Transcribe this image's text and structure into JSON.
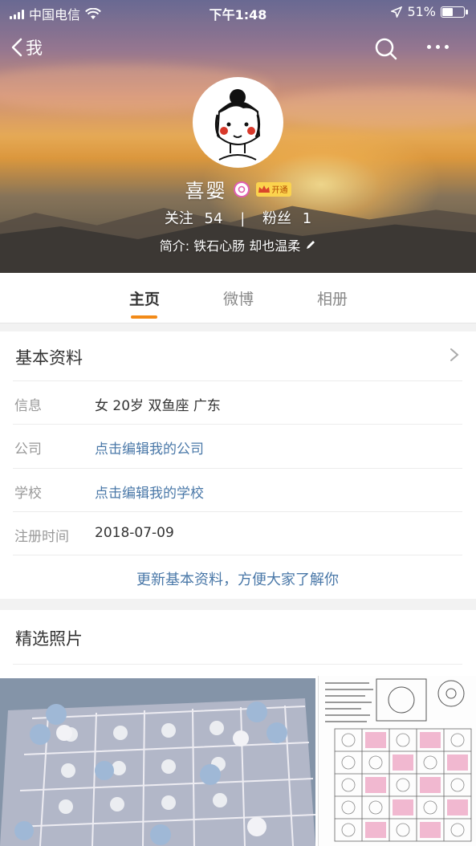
{
  "status_bar": {
    "carrier": "中国电信",
    "time": "下午1:48",
    "battery_percent": "51%",
    "battery_level": 0.51
  },
  "nav": {
    "back_label": "我"
  },
  "profile": {
    "name": "喜婴",
    "vip_badge": "开通",
    "following_label": "关注",
    "following_count": "54",
    "followers_label": "粉丝",
    "followers_count": "1",
    "bio": "简介: 铁石心肠 却也温柔"
  },
  "tabs": [
    {
      "label": "主页",
      "active": true
    },
    {
      "label": "微博",
      "active": false
    },
    {
      "label": "相册",
      "active": false
    }
  ],
  "basic_info": {
    "title": "基本资料",
    "rows": [
      {
        "label": "信息",
        "value": "女  20岁  双鱼座  广东",
        "link": false
      },
      {
        "label": "公司",
        "value": "点击编辑我的公司",
        "link": true
      },
      {
        "label": "学校",
        "value": "点击编辑我的学校",
        "link": true
      },
      {
        "label": "注册时间",
        "value": "2018-07-09",
        "link": false
      }
    ],
    "update_link": "更新基本资料，方便大家了解你"
  },
  "photos": {
    "title": "精选照片"
  },
  "colors": {
    "accent": "#f28a17",
    "link": "#4a78a8"
  }
}
